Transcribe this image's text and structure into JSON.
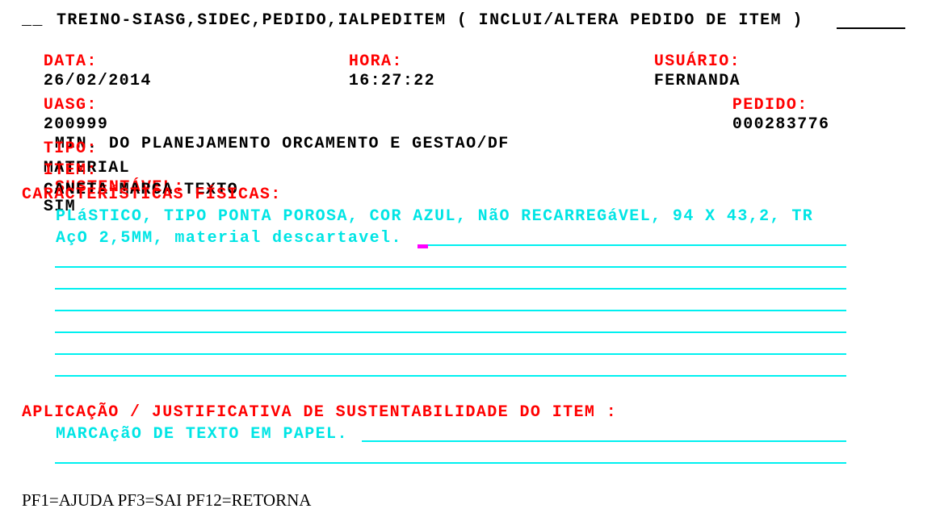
{
  "header": {
    "prefix": "__",
    "title": "TREINO-SIASG,SIDEC,PEDIDO,IALPEDITEM ( INCLUI/ALTERA PEDIDO DE ITEM )",
    "data_label": "DATA:",
    "data_value": "26/02/2014",
    "hora_label": "HORA:",
    "hora_value": "16:27:22",
    "usuario_label": "USUÁRIO:",
    "usuario_value": "FERNANDA"
  },
  "uasg": {
    "label": "UASG:",
    "code": "200999",
    "name": "MIN. DO PLANEJAMENTO ORCAMENTO E GESTAO/DF",
    "pedido_label": "PEDIDO:",
    "pedido_value": "000283776"
  },
  "item": {
    "tipo_label": "TIPO:",
    "tipo_value": "MATERIAL",
    "sustentavel_label": "SUSTENTÁVEL:",
    "sustentavel_value": "SIM",
    "item_label": "ITEM:",
    "item_value": "CANETA MARCA TEXTO"
  },
  "caracteristicas": {
    "label": "CARACTERÍSTICAS FÍSICAS:",
    "lines": [
      "PLáSTICO, TIPO PONTA POROSA, COR AZUL, NãO RECARREGáVEL, 94 X 43,2, TR",
      "AçO 2,5MM, material descartavel.",
      "",
      "",
      "",
      "",
      "",
      ""
    ]
  },
  "aplicacao": {
    "label": "APLICAÇÃO / JUSTIFICATIVA DE SUSTENTABILIDADE DO ITEM :",
    "lines": [
      "MARCAçãO DE TEXTO EM PAPEL.",
      ""
    ]
  },
  "footer": {
    "keys": "PF1=AJUDA PF3=SAI PF12=RETORNA"
  },
  "colors": {
    "label": "#ff0000",
    "value": "#000000",
    "field": "#00e5e5",
    "cursor": "#ff00ff"
  }
}
